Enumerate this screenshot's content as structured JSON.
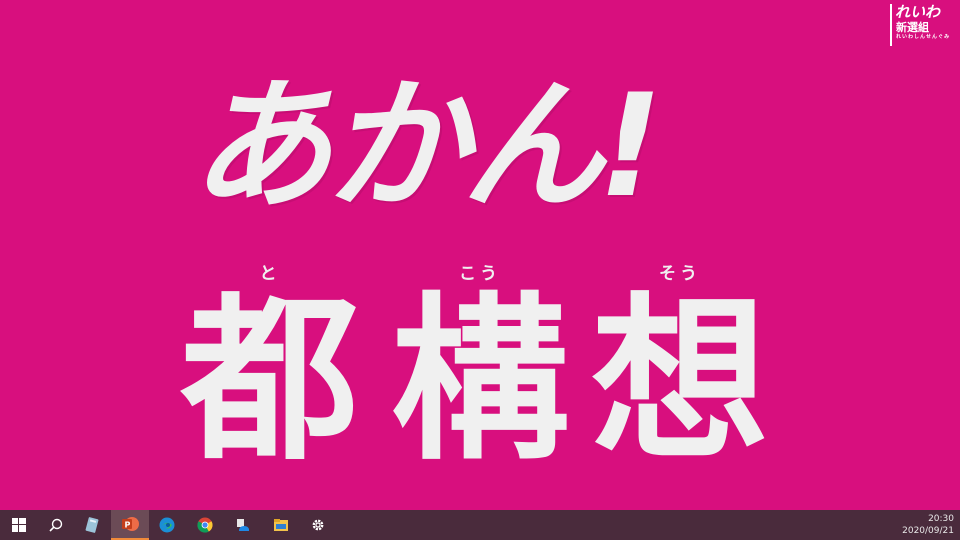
{
  "slide": {
    "headline": "あかん!",
    "kanji": [
      {
        "ruby": "と",
        "char": "都"
      },
      {
        "ruby": "こう",
        "char": "構"
      },
      {
        "ruby": "そう",
        "char": "想"
      }
    ]
  },
  "logo": {
    "main": "れいわ",
    "sub": "新選組",
    "tiny": "れいわしんせんぐみ"
  },
  "taskbar": {
    "icons": [
      "windows-start-icon",
      "search-icon",
      "app-icon",
      "powerpoint-icon",
      "edge-icon",
      "chrome-icon",
      "onedrive-icon",
      "file-explorer-icon",
      "settings-icon"
    ],
    "time": "20:30",
    "date": "2020/09/21"
  },
  "colors": {
    "background": "#d80f7e",
    "text": "#f0f0f0",
    "taskbar": "#4a2b3c"
  }
}
